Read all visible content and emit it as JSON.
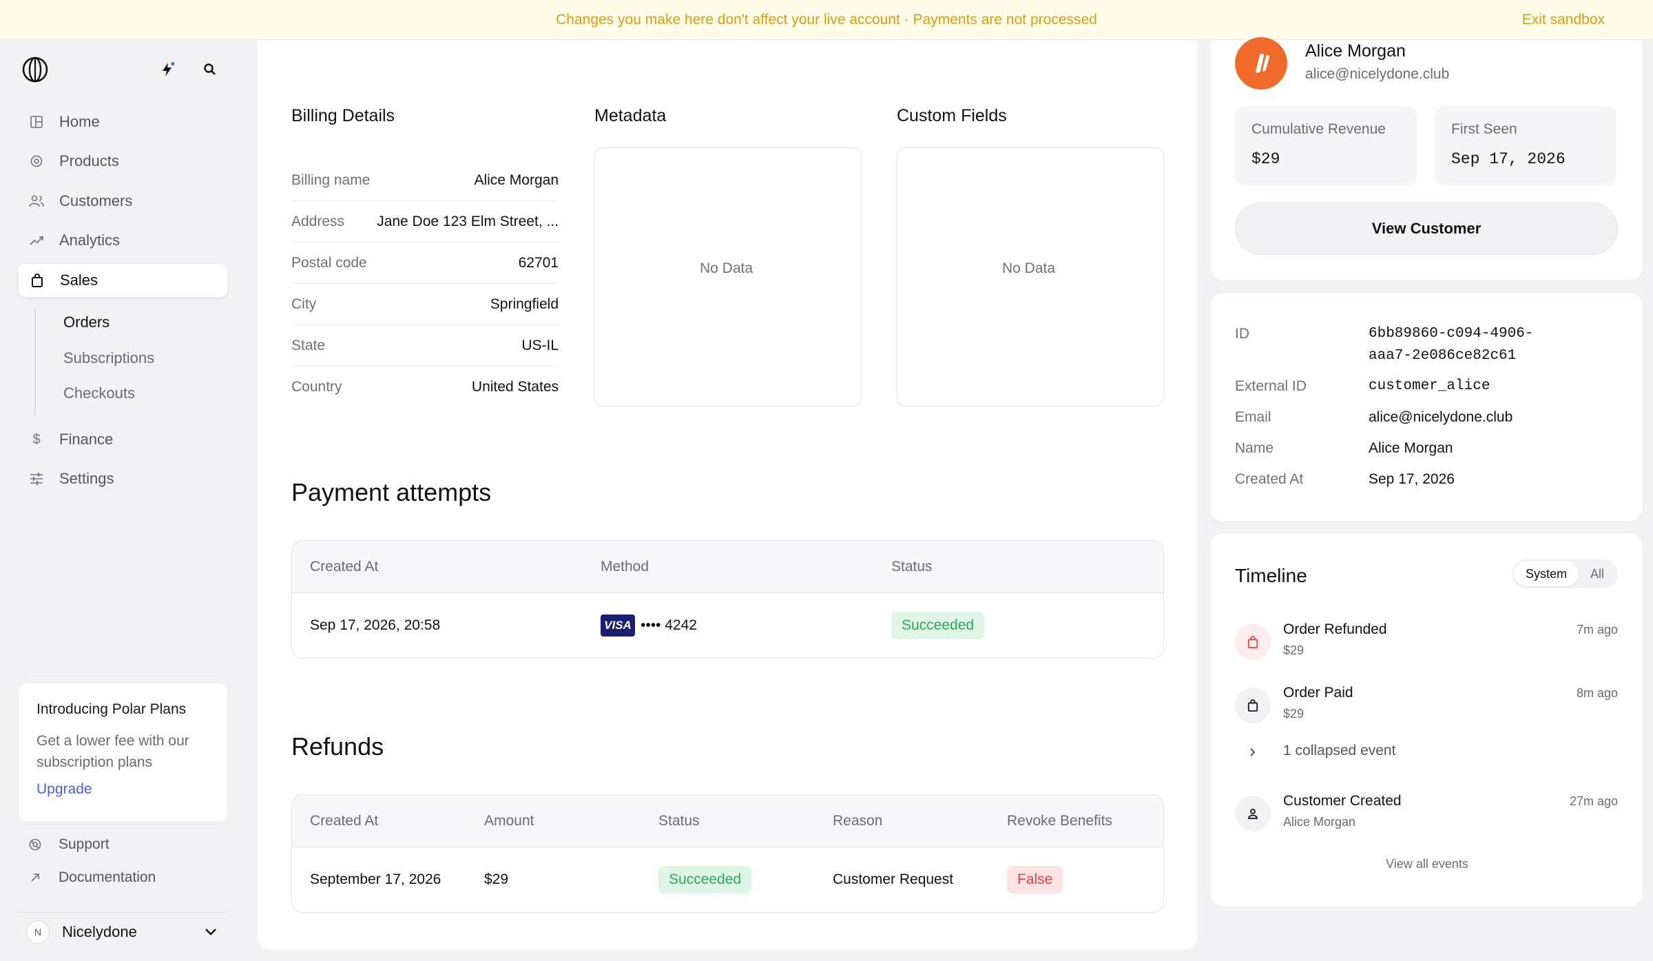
{
  "banner": {
    "message": "Changes you make here don't affect your live account · Payments are not processed",
    "exit_label": "Exit sandbox"
  },
  "sidebar": {
    "nav": [
      {
        "label": "Home",
        "icon": "home-icon"
      },
      {
        "label": "Products",
        "icon": "products-icon"
      },
      {
        "label": "Customers",
        "icon": "customers-icon"
      },
      {
        "label": "Analytics",
        "icon": "analytics-icon"
      },
      {
        "label": "Sales",
        "icon": "sales-icon",
        "active": true
      },
      {
        "label": "Finance",
        "icon": "dollar-icon"
      },
      {
        "label": "Settings",
        "icon": "settings-icon"
      }
    ],
    "sub_nav": [
      {
        "label": "Orders",
        "active": true
      },
      {
        "label": "Subscriptions"
      },
      {
        "label": "Checkouts"
      }
    ],
    "promo": {
      "title": "Introducing Polar Plans",
      "description": "Get a lower fee with our subscription plans",
      "cta": "Upgrade"
    },
    "footer_links": [
      {
        "label": "Support"
      },
      {
        "label": "Documentation"
      }
    ],
    "org": {
      "initial": "N",
      "name": "Nicelydone"
    }
  },
  "billing": {
    "title": "Billing Details",
    "rows": [
      {
        "key": "Billing name",
        "value": "Alice Morgan"
      },
      {
        "key": "Address",
        "value": "Jane Doe 123 Elm Street, ..."
      },
      {
        "key": "Postal code",
        "value": "62701"
      },
      {
        "key": "City",
        "value": "Springfield"
      },
      {
        "key": "State",
        "value": "US-IL"
      },
      {
        "key": "Country",
        "value": "United States"
      }
    ]
  },
  "metadata": {
    "title": "Metadata",
    "empty": "No Data"
  },
  "custom_fields": {
    "title": "Custom Fields",
    "empty": "No Data"
  },
  "payment_attempts": {
    "title": "Payment attempts",
    "headers": [
      "Created At",
      "Method",
      "Status"
    ],
    "rows": [
      {
        "created_at": "Sep 17, 2026, 20:58",
        "card_brand": "VISA",
        "card_mask": "•••• 4242",
        "status": "Succeeded"
      }
    ]
  },
  "refunds": {
    "title": "Refunds",
    "headers": [
      "Created At",
      "Amount",
      "Status",
      "Reason",
      "Revoke Benefits"
    ],
    "rows": [
      {
        "created_at": "September 17, 2026",
        "amount": "$29",
        "status": "Succeeded",
        "reason": "Customer Request",
        "revoke": "False"
      }
    ]
  },
  "customer": {
    "name": "Alice Morgan",
    "email": "alice@nicelydone.club",
    "stats": [
      {
        "label": "Cumulative Revenue",
        "value": "$29"
      },
      {
        "label": "First Seen",
        "value": "Sep 17, 2026"
      }
    ],
    "view_button": "View Customer",
    "details": {
      "id_label": "ID",
      "id_line1": "6bb89860-c094-4906-",
      "id_line2": "aaa7-2e086ce82c61",
      "external_id_label": "External ID",
      "external_id": "customer_alice",
      "email_label": "Email",
      "email": "alice@nicelydone.club",
      "name_label": "Name",
      "name": "Alice Morgan",
      "created_label": "Created At",
      "created": "Sep 17, 2026"
    }
  },
  "timeline": {
    "title": "Timeline",
    "tabs": [
      "System",
      "All"
    ],
    "events": [
      {
        "title": "Order Refunded",
        "sub": "$29",
        "time": "7m ago"
      },
      {
        "title": "Order Paid",
        "sub": "$29",
        "time": "8m ago"
      },
      {
        "title": "1 collapsed event"
      },
      {
        "title": "Customer Created",
        "sub": "Alice Morgan",
        "time": "27m ago"
      }
    ],
    "view_all": "View all events"
  },
  "colors": {
    "accent": "#4a5cf0",
    "success": "#2fa65a",
    "danger": "#e04444",
    "warning": "#d4a017",
    "avatar": "#f06a2a"
  }
}
